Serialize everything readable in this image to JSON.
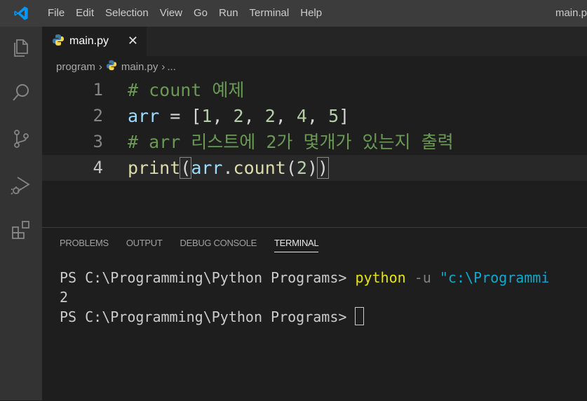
{
  "menubar": {
    "items": [
      "File",
      "Edit",
      "Selection",
      "View",
      "Go",
      "Run",
      "Terminal",
      "Help"
    ],
    "window_title": "main.p"
  },
  "activitybar": {
    "icons": [
      "explorer-icon",
      "search-icon",
      "source-control-icon",
      "run-debug-icon",
      "extensions-icon"
    ]
  },
  "tab": {
    "label": "main.py",
    "close": "✕"
  },
  "breadcrumb": {
    "folder": "program",
    "sep": "›",
    "file": "main.py",
    "more": "..."
  },
  "editor": {
    "lines": [
      {
        "number": "1",
        "parts": [
          "# count 예제"
        ]
      },
      {
        "number": "2",
        "parts": [
          "arr",
          " = [",
          "1",
          ", ",
          "2",
          ", ",
          "2",
          ", ",
          "4",
          ", ",
          "5",
          "]"
        ]
      },
      {
        "number": "3",
        "parts": [
          "# arr 리스트에 2가 몇개가 있는지 출력"
        ]
      },
      {
        "number": "4",
        "parts": [
          "print",
          "(",
          "arr",
          ".",
          "count",
          "(",
          "2",
          ")",
          ")"
        ]
      }
    ],
    "current_line": 4
  },
  "panel": {
    "tabs": [
      "PROBLEMS",
      "OUTPUT",
      "DEBUG CONSOLE",
      "TERMINAL"
    ],
    "active_tab": "TERMINAL"
  },
  "terminal": {
    "prompt": "PS C:\\Programming\\Python Programs> ",
    "cmd": "python",
    "flag": " -u ",
    "path_arg": "\"c:\\Programmi",
    "output": "2"
  },
  "colors": {
    "accent": "#007acc",
    "comment": "#6a9955",
    "number": "#b5cea8",
    "variable": "#9cdcfe",
    "function": "#dcdcaa"
  }
}
